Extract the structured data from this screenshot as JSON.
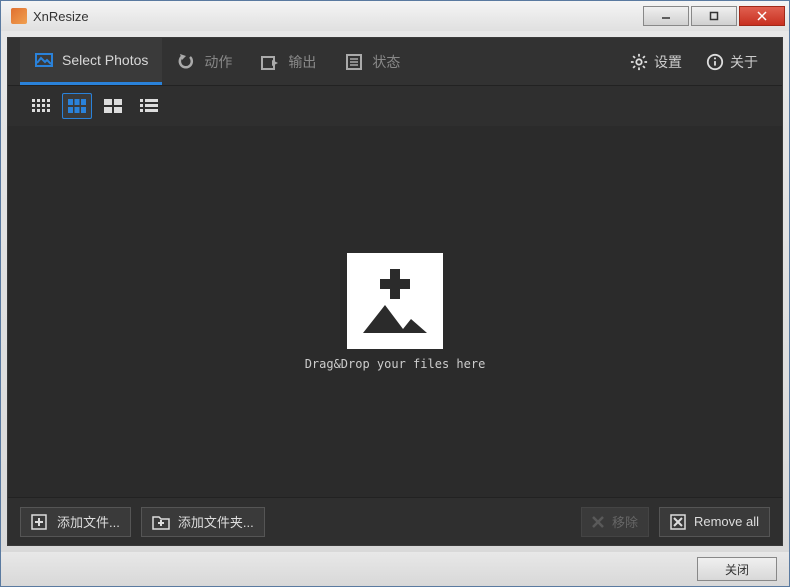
{
  "window": {
    "title": "XnResize"
  },
  "tabs": {
    "select_photos": "Select Photos",
    "actions": "动作",
    "output": "输出",
    "status": "状态"
  },
  "header_right": {
    "settings": "设置",
    "about": "关于"
  },
  "drop": {
    "label": "Drag&Drop your files here"
  },
  "buttons": {
    "add_files": "添加文件...",
    "add_folder": "添加文件夹...",
    "remove": "移除",
    "remove_all": "Remove all"
  },
  "footer": {
    "close": "关闭"
  },
  "colors": {
    "accent": "#2a82da",
    "bg_dark": "#2b2b2b"
  }
}
